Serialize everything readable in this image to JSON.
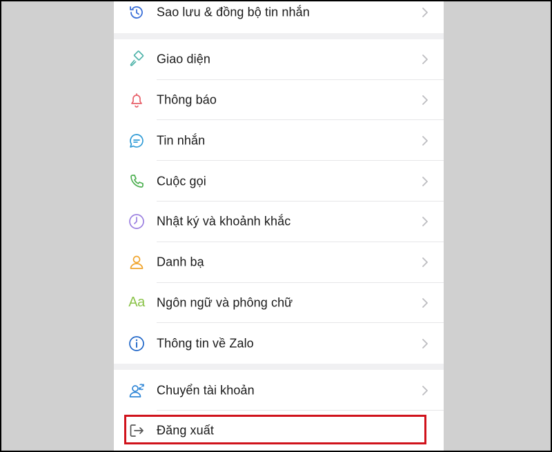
{
  "menu_top": [
    {
      "label": "Sao lưu & đồng bộ tin nhắn",
      "icon": "history-icon"
    }
  ],
  "menu_main": [
    {
      "label": "Giao diện",
      "icon": "paint-brush-icon"
    },
    {
      "label": "Thông báo",
      "icon": "bell-icon"
    },
    {
      "label": "Tin nhắn",
      "icon": "chat-bubble-icon"
    },
    {
      "label": "Cuộc gọi",
      "icon": "phone-icon"
    },
    {
      "label": "Nhật ký và khoảnh khắc",
      "icon": "clock-icon"
    },
    {
      "label": "Danh bạ",
      "icon": "person-icon"
    },
    {
      "label": "Ngôn ngữ và phông chữ",
      "icon": "font-aa-icon",
      "icon_text": "Aa"
    },
    {
      "label": "Thông tin về Zalo",
      "icon": "info-icon"
    }
  ],
  "menu_bottom": [
    {
      "label": "Chuyển tài khoản",
      "icon": "switch-account-icon"
    },
    {
      "label": "Đăng xuất",
      "icon": "logout-icon",
      "highlighted": true
    }
  ],
  "colors": {
    "highlight_border": "#d0121b",
    "separator_gap": "#f0f0f2",
    "outer_background": "#d0d0d0"
  }
}
